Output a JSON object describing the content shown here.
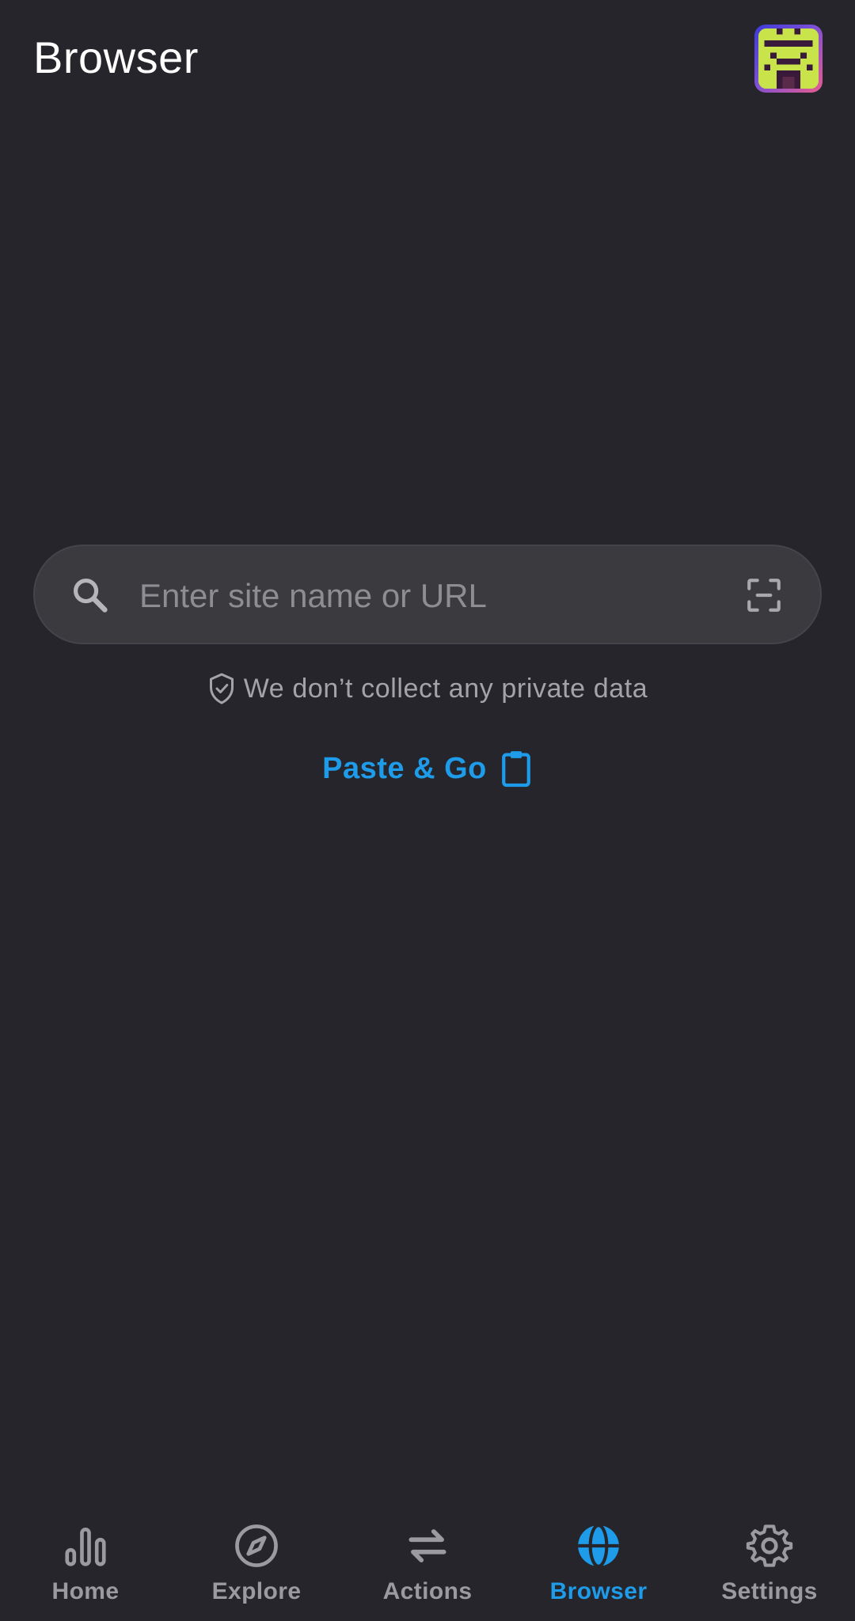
{
  "header": {
    "title": "Browser",
    "avatar_icon": "pixel-art-avatar-icon"
  },
  "search": {
    "placeholder": "Enter site name or URL",
    "value": "",
    "left_icon": "search-icon",
    "right_icon": "scan-qr-icon"
  },
  "privacy": {
    "icon": "shield-check-icon",
    "text": "We don’t collect any private data"
  },
  "paste": {
    "label": "Paste & Go",
    "icon": "clipboard-icon"
  },
  "nav": {
    "items": [
      {
        "label": "Home",
        "icon": "bar-chart-icon",
        "active": false
      },
      {
        "label": "Explore",
        "icon": "compass-icon",
        "active": false
      },
      {
        "label": "Actions",
        "icon": "swap-arrows-icon",
        "active": false
      },
      {
        "label": "Browser",
        "icon": "globe-icon",
        "active": true
      },
      {
        "label": "Settings",
        "icon": "gear-icon",
        "active": false
      }
    ]
  },
  "colors": {
    "background": "#25252b",
    "accent": "#1e9be9",
    "muted_text": "#9a9aa0",
    "search_bg": "#3a3a3f"
  }
}
